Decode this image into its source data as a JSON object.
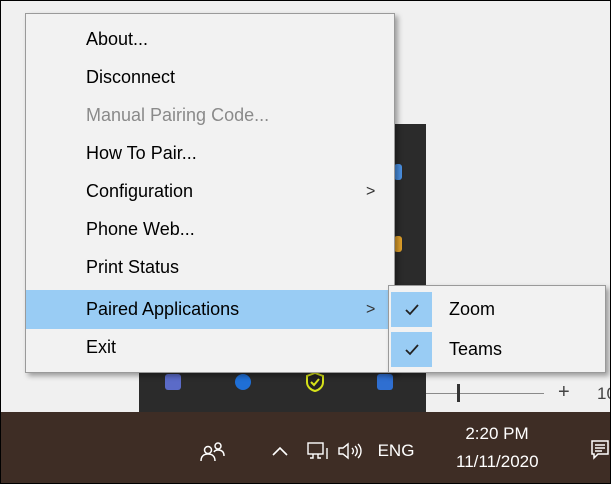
{
  "context_menu": {
    "items": [
      {
        "label": "About...",
        "disabled": false
      },
      {
        "label": "Disconnect",
        "disabled": false
      },
      {
        "label": "Manual Pairing Code...",
        "disabled": true
      },
      {
        "label": "How To Pair...",
        "disabled": false
      },
      {
        "label": "Configuration",
        "disabled": false,
        "has_submenu": true
      },
      {
        "label": "Phone Web...",
        "disabled": false
      },
      {
        "label": "Print Status",
        "disabled": false
      },
      {
        "label": "Paired Applications",
        "disabled": false,
        "has_submenu": true,
        "highlighted": true
      },
      {
        "label": "Exit",
        "disabled": false
      }
    ],
    "submenu_arrow": ">"
  },
  "paired_applications_submenu": {
    "items": [
      {
        "label": "Zoom",
        "checked": true
      },
      {
        "label": "Teams",
        "checked": true
      }
    ]
  },
  "background_window": {
    "zoom_plus": "+",
    "zoom_percent": "10"
  },
  "taskbar": {
    "language": "ENG",
    "time": "2:20 PM",
    "date": "11/11/2020",
    "icons": [
      "people-icon",
      "chevron-up-icon",
      "network-icon",
      "volume-icon",
      "notification-icon"
    ]
  },
  "tray_flyout_icons": [
    "teams-icon",
    "bluetooth-icon",
    "security-shield-icon",
    "app-icon"
  ],
  "colors": {
    "menu_bg": "#f2f2f2",
    "highlight": "#99ccf4",
    "disabled_text": "#8a8a8a",
    "taskbar_bg": "#3e2d25",
    "flyout_bg": "#2b2b2b"
  }
}
